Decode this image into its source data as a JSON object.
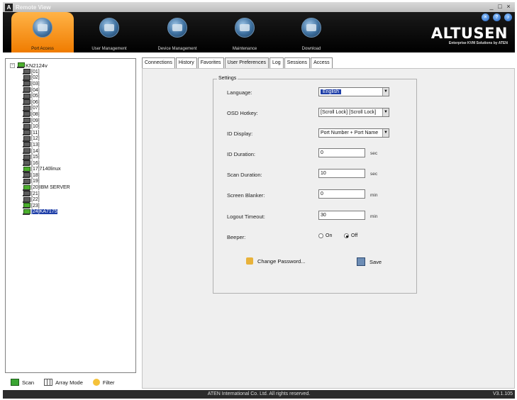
{
  "window": {
    "title": "Remote View",
    "controls": [
      "minimize-icon",
      "restore-icon",
      "close-icon"
    ]
  },
  "header": {
    "nav_tabs": [
      {
        "label": "Port Access",
        "active": true
      },
      {
        "label": "User Management",
        "active": false
      },
      {
        "label": "Device Management",
        "active": false
      },
      {
        "label": "Maintenance",
        "active": false
      },
      {
        "label": "Download",
        "active": false
      }
    ],
    "brand": {
      "name": "ALTUSEN",
      "tagline": "Enterprise KVM Solutions by ATEN"
    },
    "icons": [
      "close-circle-icon",
      "info-icon",
      "sound-icon"
    ]
  },
  "tree": {
    "root": "KN2124v",
    "ports": [
      {
        "label": "[01]",
        "online": false,
        "selected": false
      },
      {
        "label": "[02]",
        "online": false,
        "selected": false
      },
      {
        "label": "[03]",
        "online": false,
        "selected": false
      },
      {
        "label": "[04]",
        "online": false,
        "selected": false
      },
      {
        "label": "[05]",
        "online": false,
        "selected": false
      },
      {
        "label": "[06]",
        "online": false,
        "selected": false
      },
      {
        "label": "[07]",
        "online": false,
        "selected": false
      },
      {
        "label": "[08]",
        "online": false,
        "selected": false
      },
      {
        "label": "[09]",
        "online": false,
        "selected": false
      },
      {
        "label": "[10]",
        "online": false,
        "selected": false
      },
      {
        "label": "[11]",
        "online": false,
        "selected": false
      },
      {
        "label": "[12]",
        "online": false,
        "selected": false
      },
      {
        "label": "[13]",
        "online": false,
        "selected": false
      },
      {
        "label": "[14]",
        "online": false,
        "selected": false
      },
      {
        "label": "[15]",
        "online": false,
        "selected": false
      },
      {
        "label": "[16]",
        "online": false,
        "selected": false
      },
      {
        "label": "[17]7140linux",
        "online": true,
        "selected": false
      },
      {
        "label": "[18]",
        "online": false,
        "selected": false
      },
      {
        "label": "[19]",
        "online": false,
        "selected": false
      },
      {
        "label": "[20]IBM SERVER",
        "online": true,
        "selected": false
      },
      {
        "label": "[21]",
        "online": false,
        "selected": false
      },
      {
        "label": "[22]",
        "online": false,
        "selected": false
      },
      {
        "label": "[23]",
        "online": true,
        "selected": false
      },
      {
        "label": "[24]KA7175",
        "online": true,
        "selected": true
      }
    ]
  },
  "left_toolbar": {
    "scan": "Scan",
    "array_mode": "Array Mode",
    "filter": "Filter"
  },
  "tabs": [
    {
      "label": "Connections",
      "active": false
    },
    {
      "label": "History",
      "active": false
    },
    {
      "label": "Favorites",
      "active": false
    },
    {
      "label": "User Preferences",
      "active": true
    },
    {
      "label": "Log",
      "active": false
    },
    {
      "label": "Sessions",
      "active": false
    },
    {
      "label": "Access",
      "active": false
    }
  ],
  "settings": {
    "legend": "Settings",
    "language": {
      "label": "Language:",
      "value": "English"
    },
    "osd_hotkey": {
      "label": "OSD Hotkey:",
      "value": "[Scroll Lock] [Scroll Lock]"
    },
    "id_display": {
      "label": "ID Display:",
      "value": "Port Number + Port Name"
    },
    "id_duration": {
      "label": "ID Duration:",
      "value": "0",
      "unit": "sec"
    },
    "scan_duration": {
      "label": "Scan Duration:",
      "value": "10",
      "unit": "sec"
    },
    "screen_blanker": {
      "label": "Screen Blanker:",
      "value": "0",
      "unit": "min"
    },
    "logout_timeout": {
      "label": "Logout Timeout:",
      "value": "30",
      "unit": "min"
    },
    "beeper": {
      "label": "Beeper:",
      "on": "On",
      "off": "Off",
      "selected": "Off"
    },
    "change_password": "Change Password...",
    "save": "Save"
  },
  "status": {
    "copyright": "ATEN International Co. Ltd. All rights reserved.",
    "version": "V3.1.105"
  }
}
